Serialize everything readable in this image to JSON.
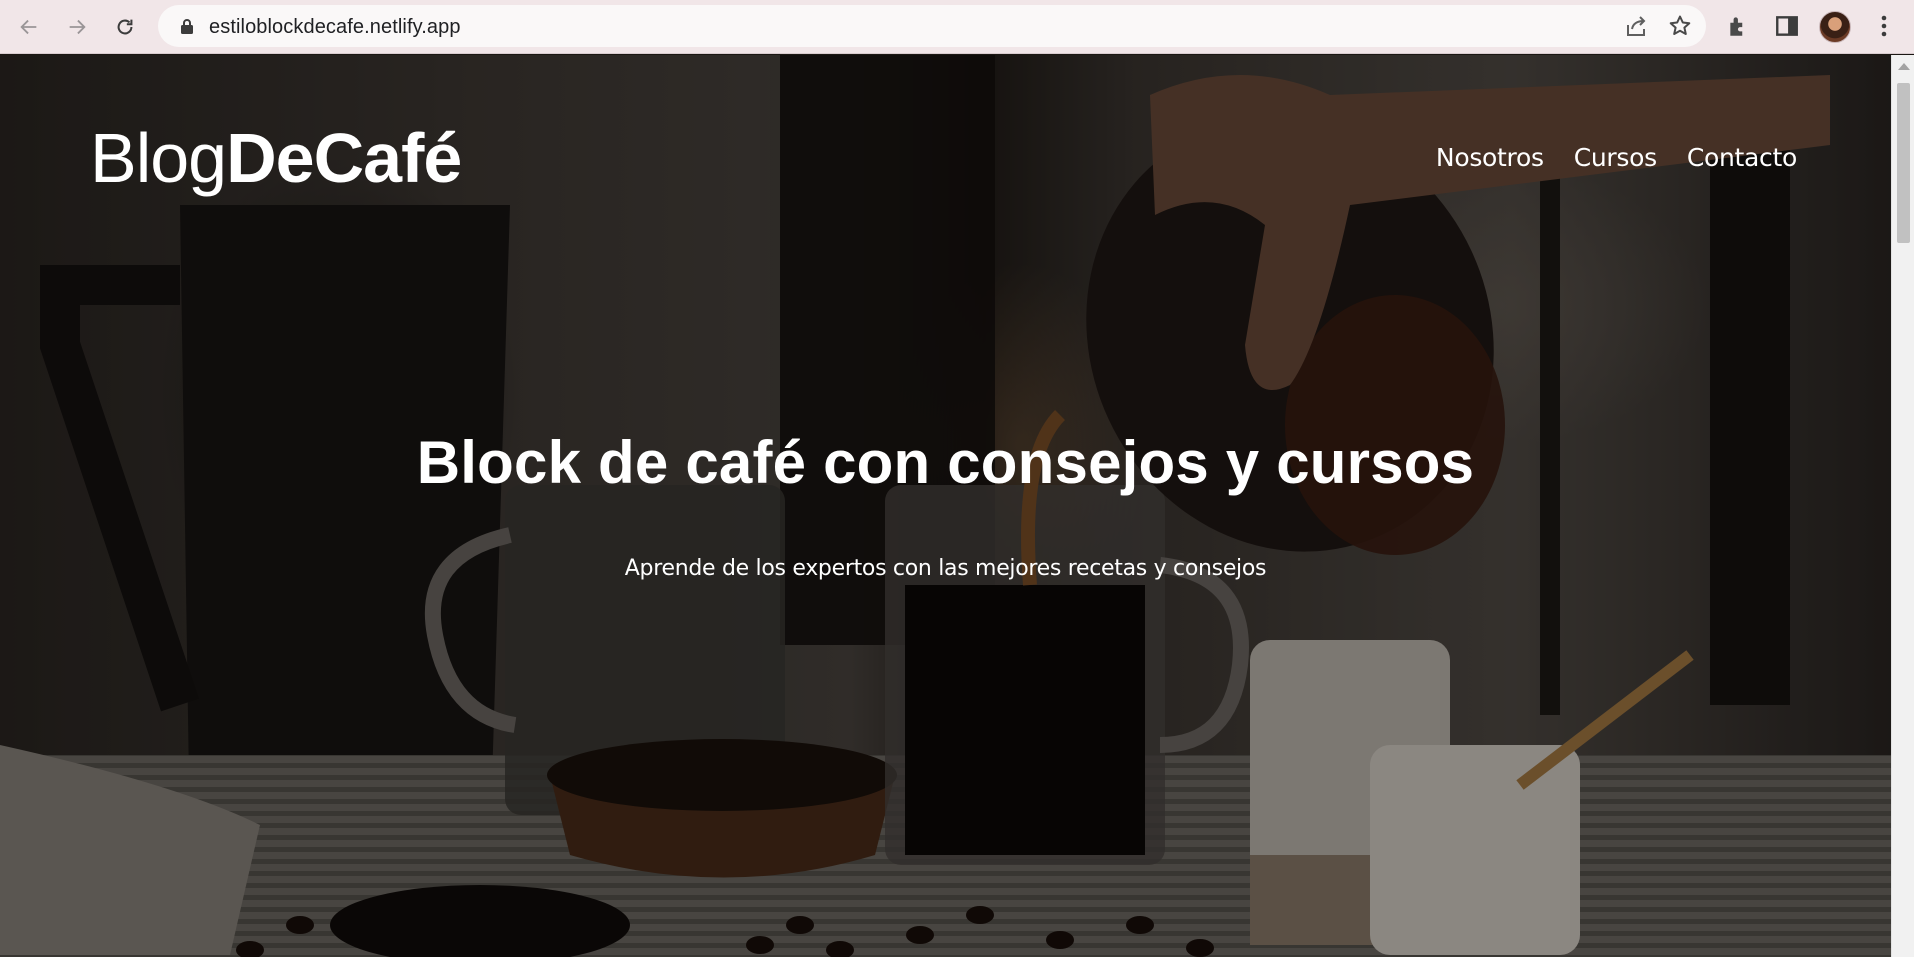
{
  "browser": {
    "url": "estiloblockdecafe.netlify.app",
    "icons": {
      "back": "arrow-left-icon",
      "forward": "arrow-right-icon",
      "reload": "reload-icon",
      "lock": "lock-icon",
      "share": "share-icon",
      "bookmark": "star-icon",
      "extensions": "puzzle-icon",
      "side_panel": "side-panel-icon",
      "menu": "kebab-menu-icon"
    }
  },
  "site": {
    "logo": {
      "part1": "Blog",
      "part2": "DeCafé"
    },
    "nav": [
      {
        "label": "Nosotros"
      },
      {
        "label": "Cursos"
      },
      {
        "label": "Contacto"
      }
    ],
    "hero": {
      "title": "Block de café con consejos y cursos",
      "subtitle": "Aprende de los expertos con las mejores recetas y consejos"
    }
  },
  "colors": {
    "chrome_bg": "#f1e6e8",
    "urlbar_bg": "#faf8f8",
    "text_on_hero": "#ffffff"
  }
}
